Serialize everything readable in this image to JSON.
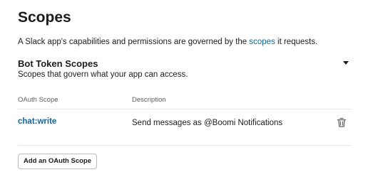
{
  "header": {
    "title": "Scopes"
  },
  "intro": {
    "text_before": "A Slack app's capabilities and permissions are governed by the ",
    "link_text": "scopes",
    "text_after": " it requests."
  },
  "bot_section": {
    "title": "Bot Token Scopes",
    "subtitle": "Scopes that govern what your app can access.",
    "toggle_icon": "caret-down-icon"
  },
  "table": {
    "columns": {
      "scope": "OAuth Scope",
      "description": "Description"
    },
    "rows": [
      {
        "scope": "chat:write",
        "description": "Send messages as @Boomi Notifications",
        "action_icon": "trash-icon"
      }
    ]
  },
  "actions": {
    "add_scope_label": "Add an OAuth Scope"
  },
  "colors": {
    "link": "#1264a3",
    "text": "#1d1c1d",
    "muted": "#616061",
    "divider": "#e8e8e8"
  }
}
